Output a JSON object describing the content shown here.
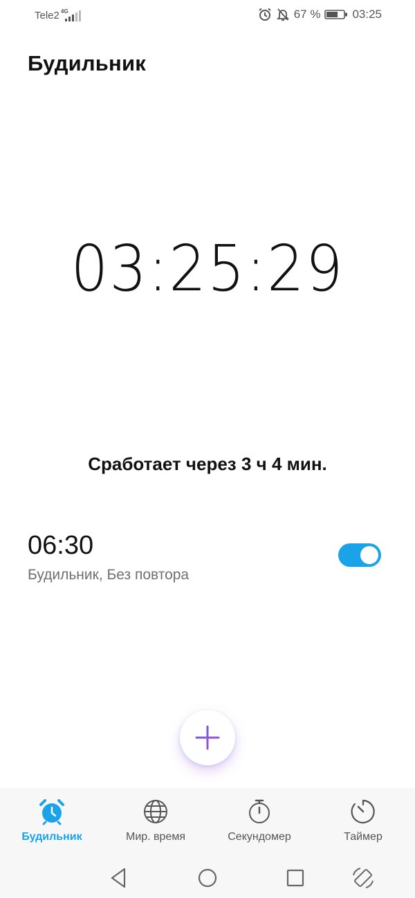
{
  "status_bar": {
    "carrier": "Tele2",
    "network": "4G",
    "battery_percent": "67 %",
    "battery_level": 0.67,
    "time": "03:25",
    "icons": [
      "alarm-icon",
      "bell-off-icon",
      "battery-icon"
    ]
  },
  "header": {
    "title": "Будильник"
  },
  "clock": {
    "time": "03:25:29"
  },
  "next_alarm": {
    "text": "Сработает через 3 ч 4 мин."
  },
  "alarms": [
    {
      "time": "06:30",
      "description": "Будильник, Без повтора",
      "enabled": true
    }
  ],
  "fab": {
    "icon": "plus-icon"
  },
  "bottom_nav": {
    "items": [
      {
        "label": "Будильник",
        "icon": "alarm-clock-icon",
        "active": true
      },
      {
        "label": "Мир. время",
        "icon": "globe-icon",
        "active": false
      },
      {
        "label": "Секундомер",
        "icon": "stopwatch-icon",
        "active": false
      },
      {
        "label": "Таймер",
        "icon": "timer-icon",
        "active": false
      }
    ]
  },
  "system_nav": {
    "icons": [
      "back-icon",
      "home-icon",
      "recents-icon",
      "rotate-icon"
    ]
  },
  "colors": {
    "accent": "#1aa3e8",
    "toggle_on": "#1aa3e8",
    "fab_plus": "#8e4fd8"
  }
}
